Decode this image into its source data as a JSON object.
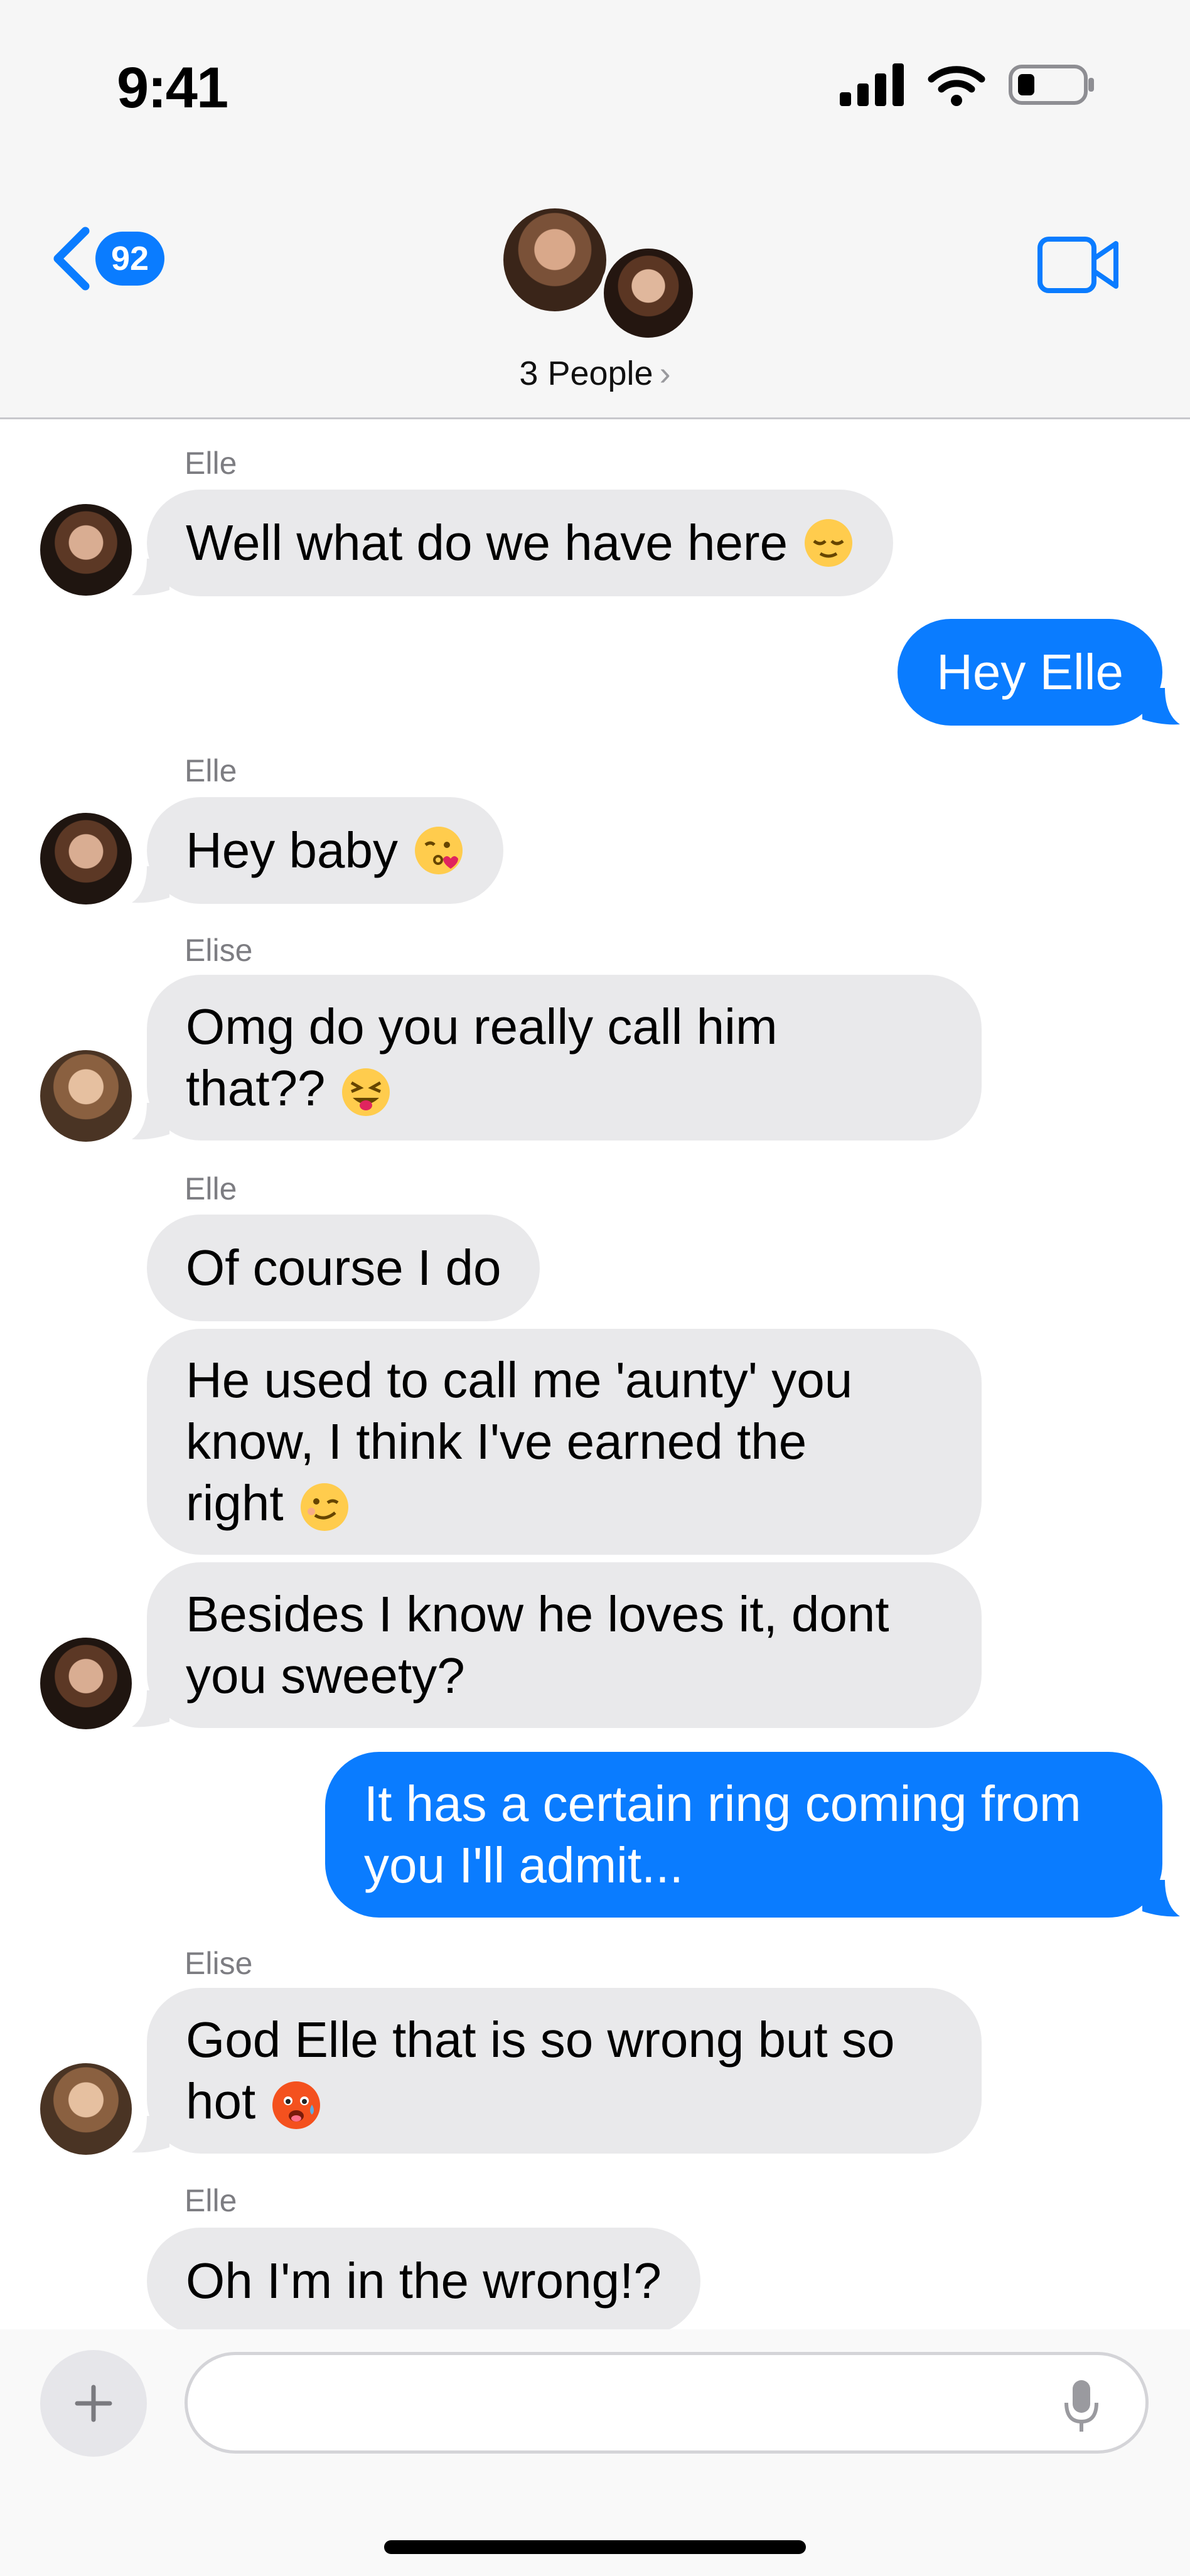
{
  "status_bar": {
    "time": "9:41"
  },
  "header": {
    "back_badge": "92",
    "title": "3 People",
    "chevron": "›"
  },
  "messages": [
    {
      "sender": "Elle",
      "side": "in",
      "text": "Well what do we have here",
      "emoji": "relieved-face"
    },
    {
      "side": "out",
      "text": "Hey Elle"
    },
    {
      "sender": "Elle",
      "side": "in",
      "text": "Hey baby",
      "emoji": "kissing-face-with-heart"
    },
    {
      "sender": "Elise",
      "side": "in",
      "text": "Omg do you really call him\nthat??",
      "emoji": "squinting-face-with-tongue"
    },
    {
      "sender": "Elle",
      "side": "in",
      "text": "Of course I do"
    },
    {
      "side": "in",
      "text": "He used to call me 'aunty' you\nknow, I think I've earned the\nright",
      "emoji": "winking-face"
    },
    {
      "side": "in",
      "text": "Besides I know he loves it, dont\nyou sweety?"
    },
    {
      "side": "out",
      "text": "It has a certain ring coming from\nyou I'll admit..."
    },
    {
      "sender": "Elise",
      "side": "in",
      "text": "God Elle that is so wrong but so\nhot",
      "emoji": "hot-face"
    },
    {
      "sender": "Elle",
      "side": "in",
      "text": "Oh I'm in the wrong!?"
    }
  ],
  "colors": {
    "accent": "#0a7cff",
    "incoming_bubble": "#e9e9eb",
    "header_bg": "#f6f6f6"
  }
}
